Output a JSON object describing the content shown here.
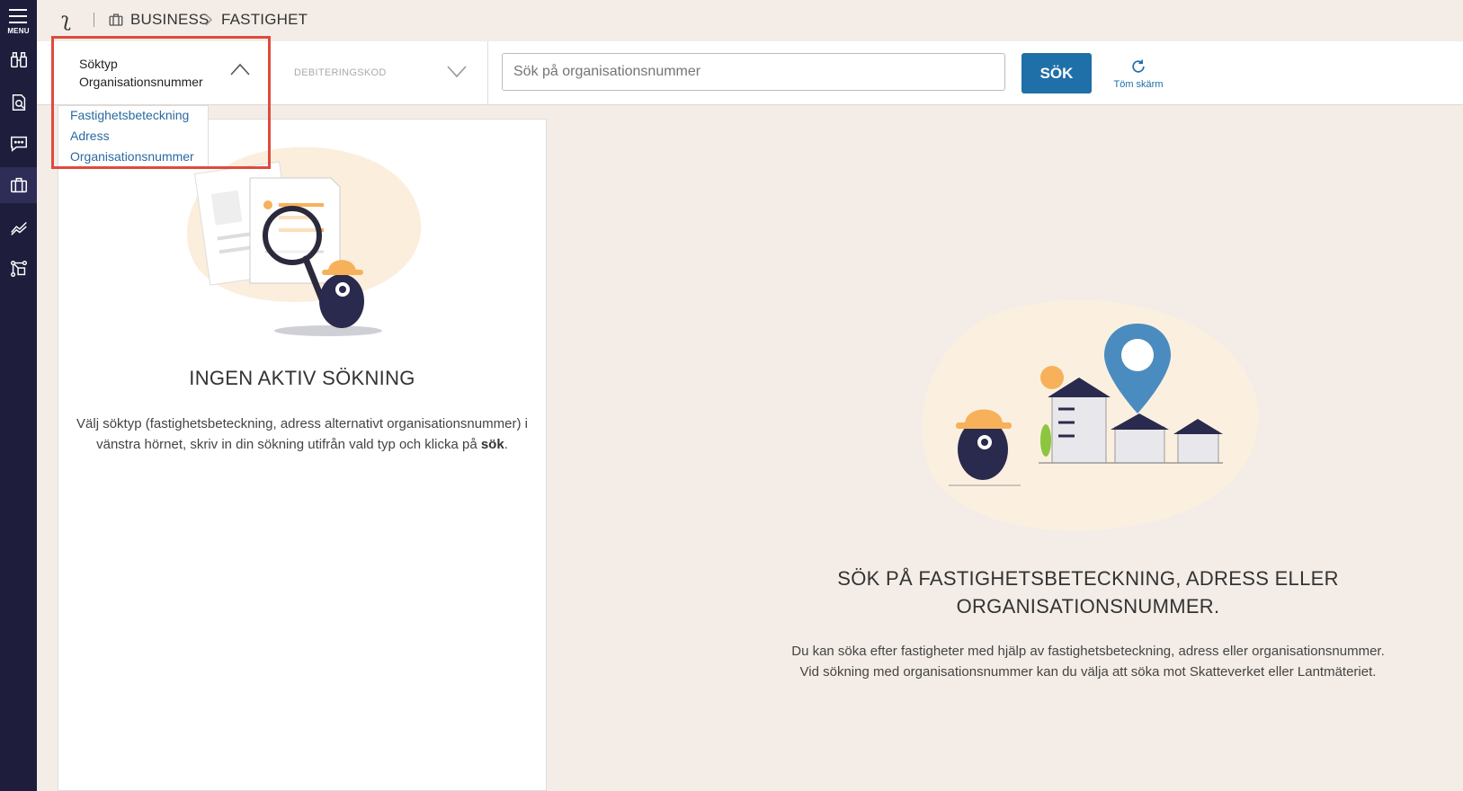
{
  "sidebar": {
    "menu_label": "MENU",
    "items": [
      {
        "icon": "binoculars-icon"
      },
      {
        "icon": "document-search-icon"
      },
      {
        "icon": "chat-icon"
      },
      {
        "icon": "briefcase-icon",
        "active": true
      },
      {
        "icon": "chart-line-icon"
      },
      {
        "icon": "network-icon"
      }
    ]
  },
  "breadcrumb": {
    "items": [
      "BUSINESS",
      "FASTIGHET"
    ]
  },
  "filters": {
    "soktyp_label": "Söktyp",
    "soktyp_value": "Organisationsnummer",
    "debitering_label": "DEBITERINGSKOD",
    "search_placeholder": "Sök på organisationsnummer",
    "search_button": "SÖK",
    "clear_button": "Töm skärm"
  },
  "dropdown": {
    "options": [
      "Fastighetsbeteckning",
      "Adress",
      "Organisationsnummer"
    ]
  },
  "left_panel": {
    "title": "INGEN AKTIV SÖKNING",
    "text_before": "Välj söktyp (fastighetsbeteckning, adress alternativt organisationsnummer) i vänstra hörnet, skriv in din sökning utifrån vald typ och klicka på ",
    "text_bold": "sök",
    "text_after": "."
  },
  "right_panel": {
    "title": "SÖK PÅ FASTIGHETSBETECKNING, ADRESS ELLER ORGANISATIONSNUMMER.",
    "text": "Du kan söka efter fastigheter med hjälp av fastighetsbeteckning, adress eller organisationsnummer. Vid sökning med organisationsnummer kan du välja att söka mot Skatteverket eller Lantmäteriet."
  },
  "colors": {
    "sidebar": "#1e1d3c",
    "accent": "#1f6fa8",
    "highlight": "#e04a3c",
    "background": "#f4ede7"
  }
}
